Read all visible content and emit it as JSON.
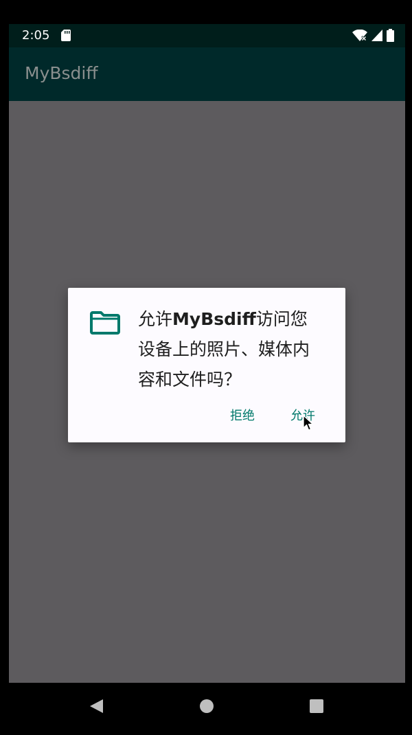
{
  "status_bar": {
    "time": "2:05",
    "icons": [
      "sd-card-icon",
      "wifi-icon",
      "signal-icon",
      "battery-icon"
    ]
  },
  "app_bar": {
    "title": "MyBsdiff"
  },
  "dialog": {
    "icon": "folder-icon",
    "message_prefix": "允许",
    "message_app": "MyBsdiff",
    "message_suffix": "访问您设备上的照片、媒体内容和文件吗？",
    "deny_label": "拒绝",
    "allow_label": "允许"
  },
  "nav_bar": {
    "icons": [
      "back-icon",
      "home-icon",
      "recents-icon"
    ]
  },
  "colors": {
    "accent": "#00796b",
    "app_bar": "#00292a",
    "status_bar": "#001e1b",
    "scrim": "#5d5b5e",
    "dialog_bg": "#fdfbff"
  }
}
